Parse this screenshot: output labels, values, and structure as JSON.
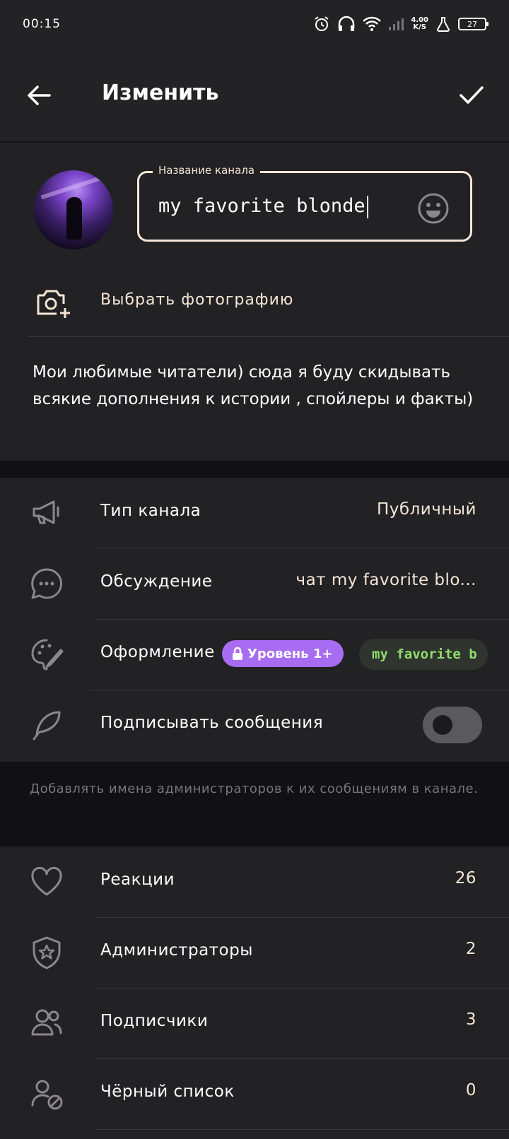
{
  "status_bar": {
    "time": "00:15",
    "net_speed_value": "4.00",
    "net_speed_unit": "K/S",
    "battery": "27"
  },
  "appbar": {
    "title": "Изменить"
  },
  "channel": {
    "name_label": "Название канала",
    "name_value": "my favorite blonde",
    "photo_label": "Выбрать фотографию",
    "description": "Мои любимые читатели) сюда я буду скидывать всякие дополнения к истории , спойлеры и факты)"
  },
  "settings": {
    "type_label": "Тип канала",
    "type_value": "Публичный",
    "discussion_label": "Обсуждение",
    "discussion_value": "чат my favorite blo...",
    "appearance_label": "Оформление",
    "appearance_badge": "Уровень 1+",
    "appearance_preview": "my favorite b",
    "sign_label": "Подписывать сообщения",
    "sign_enabled": false,
    "sign_hint": "Добавлять имена администраторов к их сообщениям в канале."
  },
  "stats": {
    "reactions_label": "Реакции",
    "reactions_value": "26",
    "admins_label": "Администраторы",
    "admins_value": "2",
    "subscribers_label": "Подписчики",
    "subscribers_value": "3",
    "blacklist_label": "Чёрный список",
    "blacklist_value": "0"
  },
  "colors": {
    "accent_cream": "#f4e6d6",
    "badge_purple": "#a86cf2",
    "theme_green": "#8fdc6e"
  }
}
